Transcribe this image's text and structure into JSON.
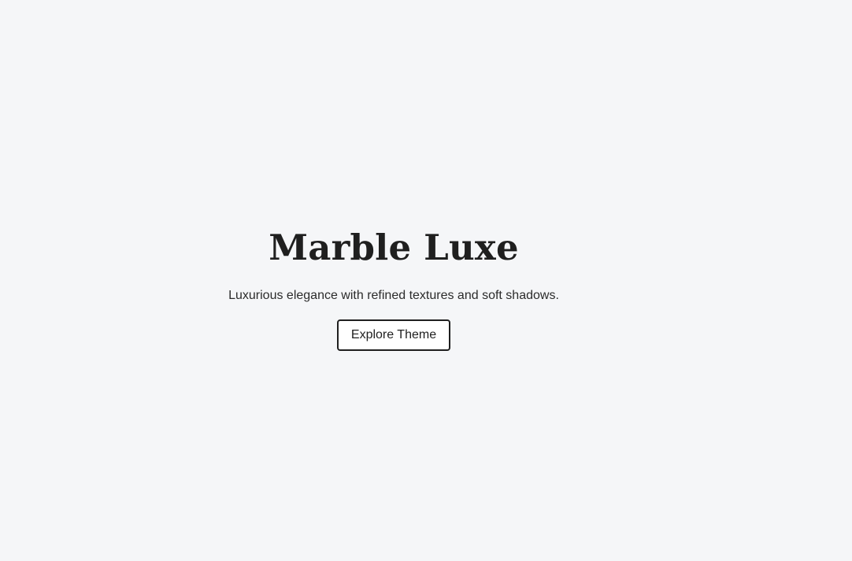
{
  "hero": {
    "title": "Marble Luxe",
    "subtitle": "Luxurious elegance with refined textures and soft shadows.",
    "cta_label": "Explore Theme"
  },
  "colors": {
    "background": "#f5f6f8",
    "text": "#1f1f1f",
    "button_border": "#1f1f1f",
    "button_background": "#ffffff"
  }
}
